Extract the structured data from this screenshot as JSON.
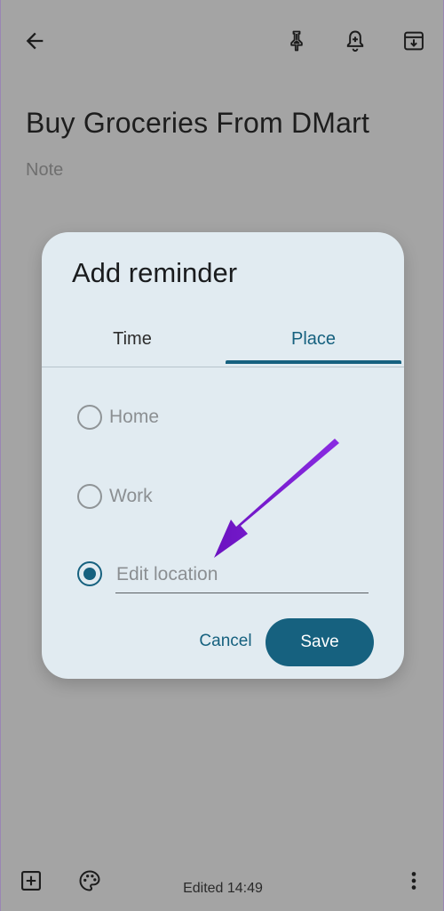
{
  "note": {
    "title": "Buy Groceries From DMart",
    "body_placeholder": "Note"
  },
  "toolbar": {
    "back_icon": "arrow-back-icon",
    "pin_icon": "pin-icon",
    "reminder_icon": "add-alert-icon",
    "archive_icon": "archive-icon"
  },
  "dialog": {
    "title": "Add reminder",
    "tabs": [
      {
        "label": "Time",
        "selected": false
      },
      {
        "label": "Place",
        "selected": true
      }
    ],
    "options": [
      {
        "label": "Home",
        "selected": false
      },
      {
        "label": "Work",
        "selected": false
      }
    ],
    "edit_location": {
      "placeholder": "Edit location",
      "value": "",
      "selected": true
    },
    "cancel_label": "Cancel",
    "save_label": "Save"
  },
  "bottom": {
    "edited_text": "Edited 14:49",
    "add_icon": "add-box-icon",
    "palette_icon": "palette-icon",
    "more_icon": "more-vert-icon"
  },
  "colors": {
    "accent": "#16617f",
    "dialog_bg": "#e1ebf1",
    "scrim_bg": "#a4a4a4",
    "annotation_arrow": "#7a1fc7"
  }
}
